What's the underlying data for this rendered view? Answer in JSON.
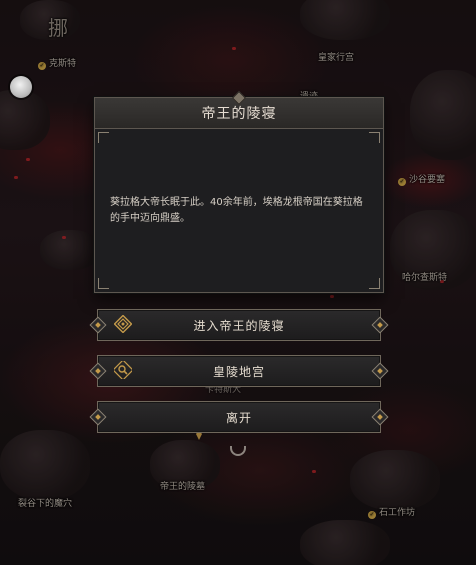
{
  "map": {
    "labels": [
      "克斯特",
      "皇家行宫",
      "沙谷要塞",
      "遗迹",
      "哈尔查斯特",
      "帝王的陵墓",
      "裂谷下的魔穴",
      "石工作坊",
      "卡特斯大",
      "挪"
    ]
  },
  "dialog": {
    "title": "帝王的陵寝",
    "body": "葵拉格大帝长眠于此。40余年前，埃格龙根帝国在葵拉格的手中迈向鼎盛。"
  },
  "options": [
    {
      "label": "进入帝王的陵寝",
      "icon": "gate-icon"
    },
    {
      "label": "皇陵地宫",
      "icon": "search-icon"
    },
    {
      "label": "离开",
      "icon": ""
    }
  ],
  "colors": {
    "accent_gold": "#c49a4a",
    "dialog_bg": "#1e1e20",
    "border": "#6f675b"
  }
}
